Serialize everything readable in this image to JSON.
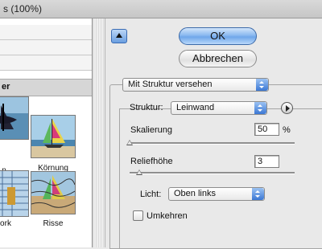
{
  "window": {
    "title_fragment": "s (100%)"
  },
  "left_panel": {
    "category_label": "er",
    "thumbnails": [
      {
        "label": "n"
      },
      {
        "label": "Körnung"
      },
      {
        "label": "ork"
      },
      {
        "label": "Risse"
      }
    ]
  },
  "buttons": {
    "ok": "OK",
    "cancel": "Abbrechen"
  },
  "filter_select": {
    "value": "Mit Struktur versehen"
  },
  "structure": {
    "label": "Struktur:",
    "value": "Leinwand",
    "scaling_label": "Skalierung",
    "scaling_value": "50",
    "scaling_unit": "%",
    "scaling_fraction": 0.0,
    "relief_label": "Reliefhöhe",
    "relief_value": "3",
    "relief_fraction": 0.06,
    "light_label": "Licht:",
    "light_value": "Oben links",
    "invert_label": "Umkehren",
    "invert_checked": false
  },
  "colors": {
    "accent_blue": "#6fa6ea",
    "panel_bg": "#e9e9e9"
  }
}
